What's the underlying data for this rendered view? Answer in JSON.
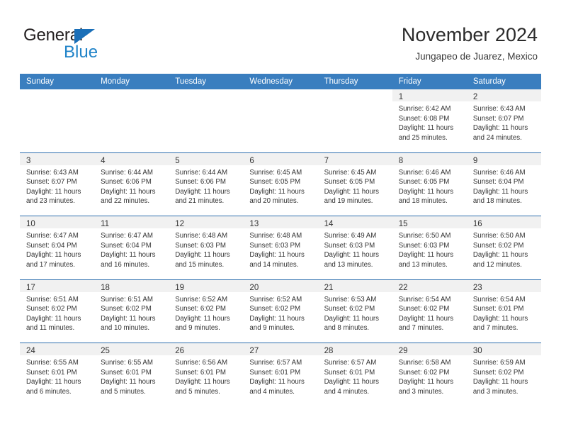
{
  "logo": {
    "word_one": "General",
    "word_two": "Blue",
    "triangle_icon": "triangle-icon",
    "brand_blue": "#2083c8",
    "brand_dark": "#231f20"
  },
  "header": {
    "title": "November 2024",
    "subtitle": "Jungapeo de Juarez, Mexico"
  },
  "calendar": {
    "header_bg": "#3a7ebf",
    "row_divider": "#2f6fae",
    "datenum_bg": "#f1f1f1",
    "weekdays": [
      "Sunday",
      "Monday",
      "Tuesday",
      "Wednesday",
      "Thursday",
      "Friday",
      "Saturday"
    ],
    "weeks": [
      [
        {
          "date": "",
          "sunrise": "",
          "sunset": "",
          "daylight_line1": "",
          "daylight_line2": ""
        },
        {
          "date": "",
          "sunrise": "",
          "sunset": "",
          "daylight_line1": "",
          "daylight_line2": ""
        },
        {
          "date": "",
          "sunrise": "",
          "sunset": "",
          "daylight_line1": "",
          "daylight_line2": ""
        },
        {
          "date": "",
          "sunrise": "",
          "sunset": "",
          "daylight_line1": "",
          "daylight_line2": ""
        },
        {
          "date": "",
          "sunrise": "",
          "sunset": "",
          "daylight_line1": "",
          "daylight_line2": ""
        },
        {
          "date": "1",
          "sunrise": "Sunrise: 6:42 AM",
          "sunset": "Sunset: 6:08 PM",
          "daylight_line1": "Daylight: 11 hours",
          "daylight_line2": "and 25 minutes."
        },
        {
          "date": "2",
          "sunrise": "Sunrise: 6:43 AM",
          "sunset": "Sunset: 6:07 PM",
          "daylight_line1": "Daylight: 11 hours",
          "daylight_line2": "and 24 minutes."
        }
      ],
      [
        {
          "date": "3",
          "sunrise": "Sunrise: 6:43 AM",
          "sunset": "Sunset: 6:07 PM",
          "daylight_line1": "Daylight: 11 hours",
          "daylight_line2": "and 23 minutes."
        },
        {
          "date": "4",
          "sunrise": "Sunrise: 6:44 AM",
          "sunset": "Sunset: 6:06 PM",
          "daylight_line1": "Daylight: 11 hours",
          "daylight_line2": "and 22 minutes."
        },
        {
          "date": "5",
          "sunrise": "Sunrise: 6:44 AM",
          "sunset": "Sunset: 6:06 PM",
          "daylight_line1": "Daylight: 11 hours",
          "daylight_line2": "and 21 minutes."
        },
        {
          "date": "6",
          "sunrise": "Sunrise: 6:45 AM",
          "sunset": "Sunset: 6:05 PM",
          "daylight_line1": "Daylight: 11 hours",
          "daylight_line2": "and 20 minutes."
        },
        {
          "date": "7",
          "sunrise": "Sunrise: 6:45 AM",
          "sunset": "Sunset: 6:05 PM",
          "daylight_line1": "Daylight: 11 hours",
          "daylight_line2": "and 19 minutes."
        },
        {
          "date": "8",
          "sunrise": "Sunrise: 6:46 AM",
          "sunset": "Sunset: 6:05 PM",
          "daylight_line1": "Daylight: 11 hours",
          "daylight_line2": "and 18 minutes."
        },
        {
          "date": "9",
          "sunrise": "Sunrise: 6:46 AM",
          "sunset": "Sunset: 6:04 PM",
          "daylight_line1": "Daylight: 11 hours",
          "daylight_line2": "and 18 minutes."
        }
      ],
      [
        {
          "date": "10",
          "sunrise": "Sunrise: 6:47 AM",
          "sunset": "Sunset: 6:04 PM",
          "daylight_line1": "Daylight: 11 hours",
          "daylight_line2": "and 17 minutes."
        },
        {
          "date": "11",
          "sunrise": "Sunrise: 6:47 AM",
          "sunset": "Sunset: 6:04 PM",
          "daylight_line1": "Daylight: 11 hours",
          "daylight_line2": "and 16 minutes."
        },
        {
          "date": "12",
          "sunrise": "Sunrise: 6:48 AM",
          "sunset": "Sunset: 6:03 PM",
          "daylight_line1": "Daylight: 11 hours",
          "daylight_line2": "and 15 minutes."
        },
        {
          "date": "13",
          "sunrise": "Sunrise: 6:48 AM",
          "sunset": "Sunset: 6:03 PM",
          "daylight_line1": "Daylight: 11 hours",
          "daylight_line2": "and 14 minutes."
        },
        {
          "date": "14",
          "sunrise": "Sunrise: 6:49 AM",
          "sunset": "Sunset: 6:03 PM",
          "daylight_line1": "Daylight: 11 hours",
          "daylight_line2": "and 13 minutes."
        },
        {
          "date": "15",
          "sunrise": "Sunrise: 6:50 AM",
          "sunset": "Sunset: 6:03 PM",
          "daylight_line1": "Daylight: 11 hours",
          "daylight_line2": "and 13 minutes."
        },
        {
          "date": "16",
          "sunrise": "Sunrise: 6:50 AM",
          "sunset": "Sunset: 6:02 PM",
          "daylight_line1": "Daylight: 11 hours",
          "daylight_line2": "and 12 minutes."
        }
      ],
      [
        {
          "date": "17",
          "sunrise": "Sunrise: 6:51 AM",
          "sunset": "Sunset: 6:02 PM",
          "daylight_line1": "Daylight: 11 hours",
          "daylight_line2": "and 11 minutes."
        },
        {
          "date": "18",
          "sunrise": "Sunrise: 6:51 AM",
          "sunset": "Sunset: 6:02 PM",
          "daylight_line1": "Daylight: 11 hours",
          "daylight_line2": "and 10 minutes."
        },
        {
          "date": "19",
          "sunrise": "Sunrise: 6:52 AM",
          "sunset": "Sunset: 6:02 PM",
          "daylight_line1": "Daylight: 11 hours",
          "daylight_line2": "and 9 minutes."
        },
        {
          "date": "20",
          "sunrise": "Sunrise: 6:52 AM",
          "sunset": "Sunset: 6:02 PM",
          "daylight_line1": "Daylight: 11 hours",
          "daylight_line2": "and 9 minutes."
        },
        {
          "date": "21",
          "sunrise": "Sunrise: 6:53 AM",
          "sunset": "Sunset: 6:02 PM",
          "daylight_line1": "Daylight: 11 hours",
          "daylight_line2": "and 8 minutes."
        },
        {
          "date": "22",
          "sunrise": "Sunrise: 6:54 AM",
          "sunset": "Sunset: 6:02 PM",
          "daylight_line1": "Daylight: 11 hours",
          "daylight_line2": "and 7 minutes."
        },
        {
          "date": "23",
          "sunrise": "Sunrise: 6:54 AM",
          "sunset": "Sunset: 6:01 PM",
          "daylight_line1": "Daylight: 11 hours",
          "daylight_line2": "and 7 minutes."
        }
      ],
      [
        {
          "date": "24",
          "sunrise": "Sunrise: 6:55 AM",
          "sunset": "Sunset: 6:01 PM",
          "daylight_line1": "Daylight: 11 hours",
          "daylight_line2": "and 6 minutes."
        },
        {
          "date": "25",
          "sunrise": "Sunrise: 6:55 AM",
          "sunset": "Sunset: 6:01 PM",
          "daylight_line1": "Daylight: 11 hours",
          "daylight_line2": "and 5 minutes."
        },
        {
          "date": "26",
          "sunrise": "Sunrise: 6:56 AM",
          "sunset": "Sunset: 6:01 PM",
          "daylight_line1": "Daylight: 11 hours",
          "daylight_line2": "and 5 minutes."
        },
        {
          "date": "27",
          "sunrise": "Sunrise: 6:57 AM",
          "sunset": "Sunset: 6:01 PM",
          "daylight_line1": "Daylight: 11 hours",
          "daylight_line2": "and 4 minutes."
        },
        {
          "date": "28",
          "sunrise": "Sunrise: 6:57 AM",
          "sunset": "Sunset: 6:01 PM",
          "daylight_line1": "Daylight: 11 hours",
          "daylight_line2": "and 4 minutes."
        },
        {
          "date": "29",
          "sunrise": "Sunrise: 6:58 AM",
          "sunset": "Sunset: 6:02 PM",
          "daylight_line1": "Daylight: 11 hours",
          "daylight_line2": "and 3 minutes."
        },
        {
          "date": "30",
          "sunrise": "Sunrise: 6:59 AM",
          "sunset": "Sunset: 6:02 PM",
          "daylight_line1": "Daylight: 11 hours",
          "daylight_line2": "and 3 minutes."
        }
      ]
    ]
  }
}
